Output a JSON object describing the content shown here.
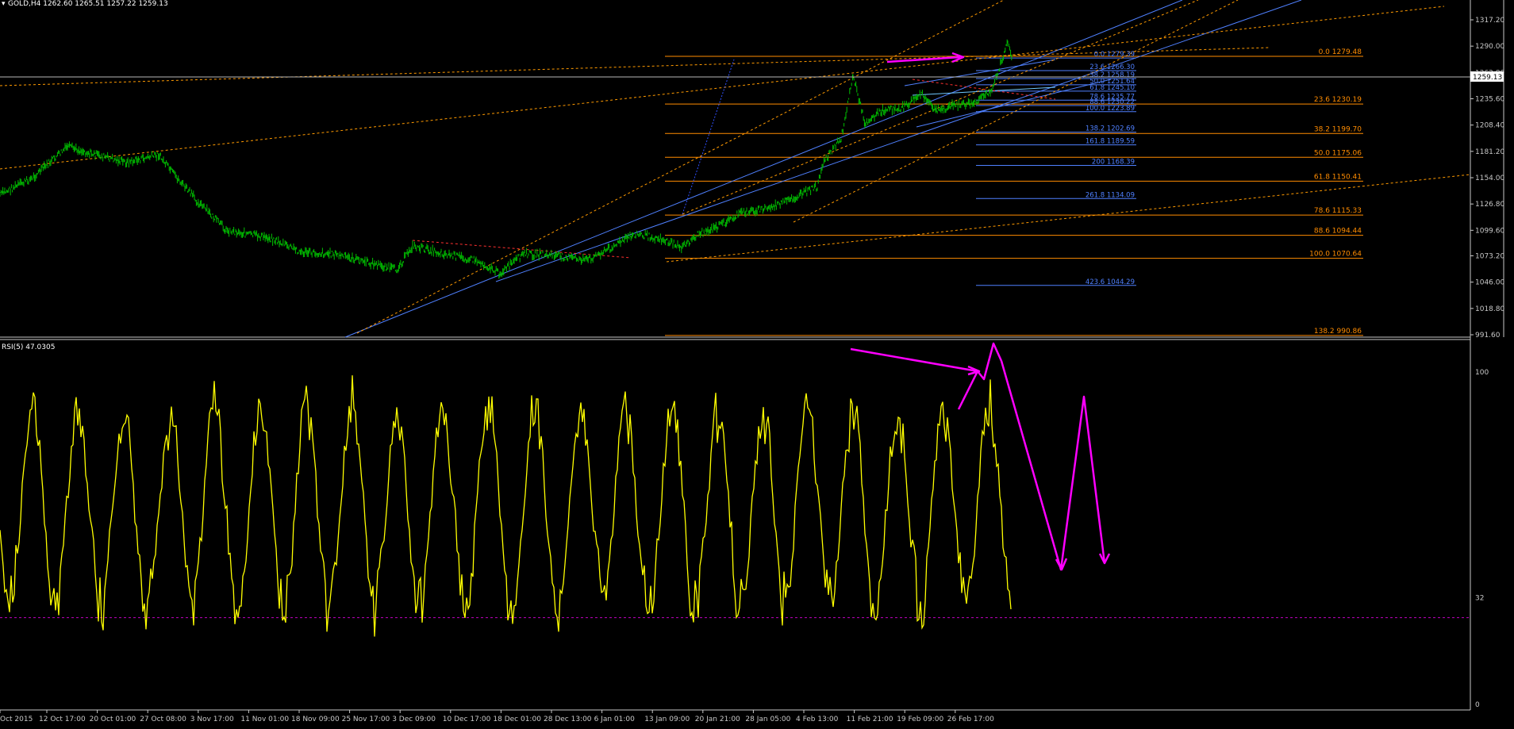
{
  "window": {
    "symbol_caption": "GOLD,H4  1262.60 1265.51 1257.22 1259.13",
    "current_price": "1259.13"
  },
  "colors": {
    "background": "#000000",
    "candle": "#00c000",
    "fib_retrace": "#ff8c00",
    "fib_extension": "#4f80ff",
    "trend_blue": "#4f80ff",
    "trend_orange": "#ff9a00",
    "trend_red": "#ff3030",
    "annotation": "#ff00ff",
    "rsi_line": "#ffff00",
    "rsi_level": "#c000c0",
    "axis": "#c8c8c8"
  },
  "price_axis": {
    "labels": [
      "1317.20",
      "1290.00",
      "1262.80",
      "1235.60",
      "1208.40",
      "1181.20",
      "1154.00",
      "1126.80",
      "1099.60",
      "1073.20",
      "1046.00",
      "1018.80",
      "991.60"
    ]
  },
  "rsi": {
    "caption": "RSI(5) 47.0305",
    "axis_labels": [
      "100",
      "32",
      "0"
    ],
    "level": 32
  },
  "time_axis": {
    "labels": [
      "Oct 2015",
      "12 Oct 17:00",
      "20 Oct 01:00",
      "27 Oct 08:00",
      "3 Nov 17:00",
      "11 Nov 01:00",
      "18 Nov 09:00",
      "25 Nov 17:00",
      "3 Dec 09:00",
      "10 Dec 17:00",
      "18 Dec 01:00",
      "28 Dec 13:00",
      "6 Jan 01:00",
      "13 Jan 09:00",
      "20 Jan 21:00",
      "28 Jan 05:00",
      "4 Feb 13:00",
      "11 Feb 21:00",
      "19 Feb 09:00",
      "26 Feb 17:00"
    ]
  },
  "fib_retrace_levels": [
    {
      "label": "0.0  1279.48"
    },
    {
      "label": "23.6  1230.19"
    },
    {
      "label": "38.2  1199.70"
    },
    {
      "label": "50.0  1175.06"
    },
    {
      "label": "61.8  1150.41"
    },
    {
      "label": "78.6  1115.33"
    },
    {
      "label": "88.6  1094.44"
    },
    {
      "label": "100.0  1070.64"
    },
    {
      "label": "138.2  990.86"
    }
  ],
  "fib_extension_levels": [
    {
      "label": "0.0  1279.39"
    },
    {
      "label": "23.6  1266.30"
    },
    {
      "label": "38.2  1258.19"
    },
    {
      "label": "50.0  1251.64"
    },
    {
      "label": "61.8  1245.10"
    },
    {
      "label": "78.6  1235.77"
    },
    {
      "label": "88.6  1230.22"
    },
    {
      "label": "100.0  1223.89"
    },
    {
      "label": "138.2  1202.69"
    },
    {
      "label": "161.8  1189.59"
    },
    {
      "label": "200  1168.39"
    },
    {
      "label": "261.8  1134.09"
    },
    {
      "label": "423.6  1044.29"
    }
  ]
}
